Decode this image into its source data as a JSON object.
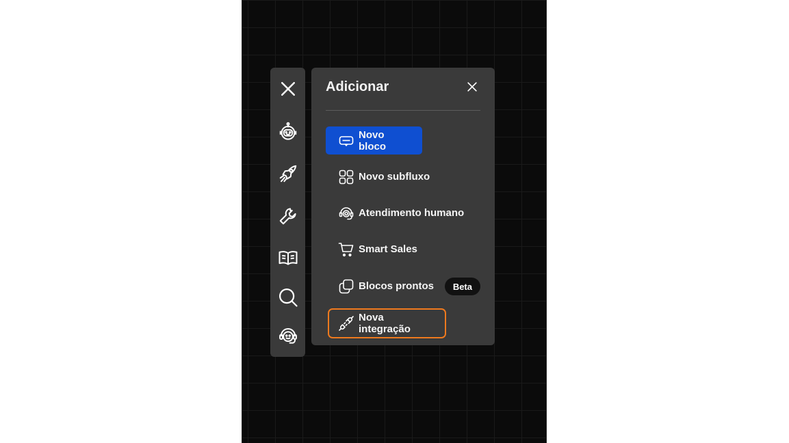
{
  "panel": {
    "title": "Adicionar",
    "items": [
      {
        "label": "Novo bloco",
        "icon": "block-icon",
        "state": "selected"
      },
      {
        "label": "Novo subfluxo",
        "icon": "grid-icon"
      },
      {
        "label": "Atendimento humano",
        "icon": "headset-icon"
      },
      {
        "label": "Smart Sales",
        "icon": "cart-icon"
      },
      {
        "label": "Blocos prontos",
        "icon": "copy-icon",
        "badge": "Beta"
      },
      {
        "label": "Nova integração",
        "icon": "plug-icon",
        "state": "focused"
      }
    ]
  },
  "rail": {
    "icons": [
      "close-icon",
      "robot-icon",
      "rocket-icon",
      "wrench-icon",
      "book-icon",
      "search-icon",
      "support-agent-icon"
    ]
  },
  "colors": {
    "canvas": "#0b0b0b",
    "panel": "#3a3a3a",
    "accent": "#0f4fd1",
    "focus": "#f07a1e",
    "badge": "#111111"
  }
}
